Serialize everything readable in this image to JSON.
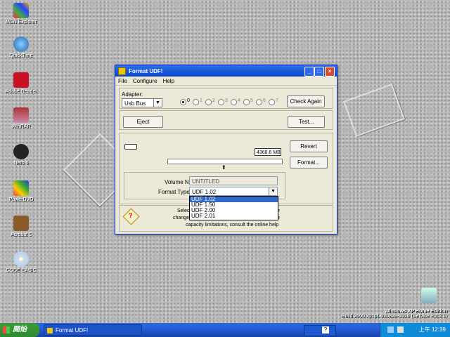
{
  "desktop": {
    "icons": [
      {
        "label": "MSN Explorer"
      },
      {
        "label": "QuickTime"
      },
      {
        "label": "Adobe Reader"
      },
      {
        "label": "WinRAR"
      },
      {
        "label": "Nero 6"
      },
      {
        "label": "PowerDVD"
      },
      {
        "label": "Acrobat 5"
      },
      {
        "label": "CODE BASIC"
      }
    ],
    "os_banner": {
      "line1": "Windows XP Home Edition",
      "line2": "Build 2600.xpsp1.020828-1920 (Service Pack 1)"
    }
  },
  "window": {
    "title": "Format UDF!",
    "menu": [
      "File",
      "Configure",
      "Help"
    ],
    "adapter_label": "Adapter:",
    "adapter_value": "Usb Bus",
    "radio_labels": [
      "0",
      "1",
      "2",
      "3",
      "4",
      "5",
      "6",
      "7"
    ],
    "check_again": "Check Again",
    "eject": "Eject",
    "test": "Test...",
    "capacity": "4368.6 MB",
    "revert": "Revert",
    "format": "Format...",
    "volume_name_label": "Volume Name:",
    "volume_name_value": "UNTITLED",
    "format_type_label": "Format Type:",
    "format_type_value": "UDF 1.02",
    "format_options": [
      "UDF 1.02",
      "UDF 1.50",
      "UDF 2.00",
      "UDF 2.01"
    ],
    "info_line1": "Select",
    "info_line2": "change",
    "info_line3": "capacity limitations, consult the online help",
    "info_right1": "e",
    "info_right2": "e"
  },
  "taskbar": {
    "start_label": "開始",
    "task_label": "Format UDF!",
    "clock": "上午 12:39"
  }
}
